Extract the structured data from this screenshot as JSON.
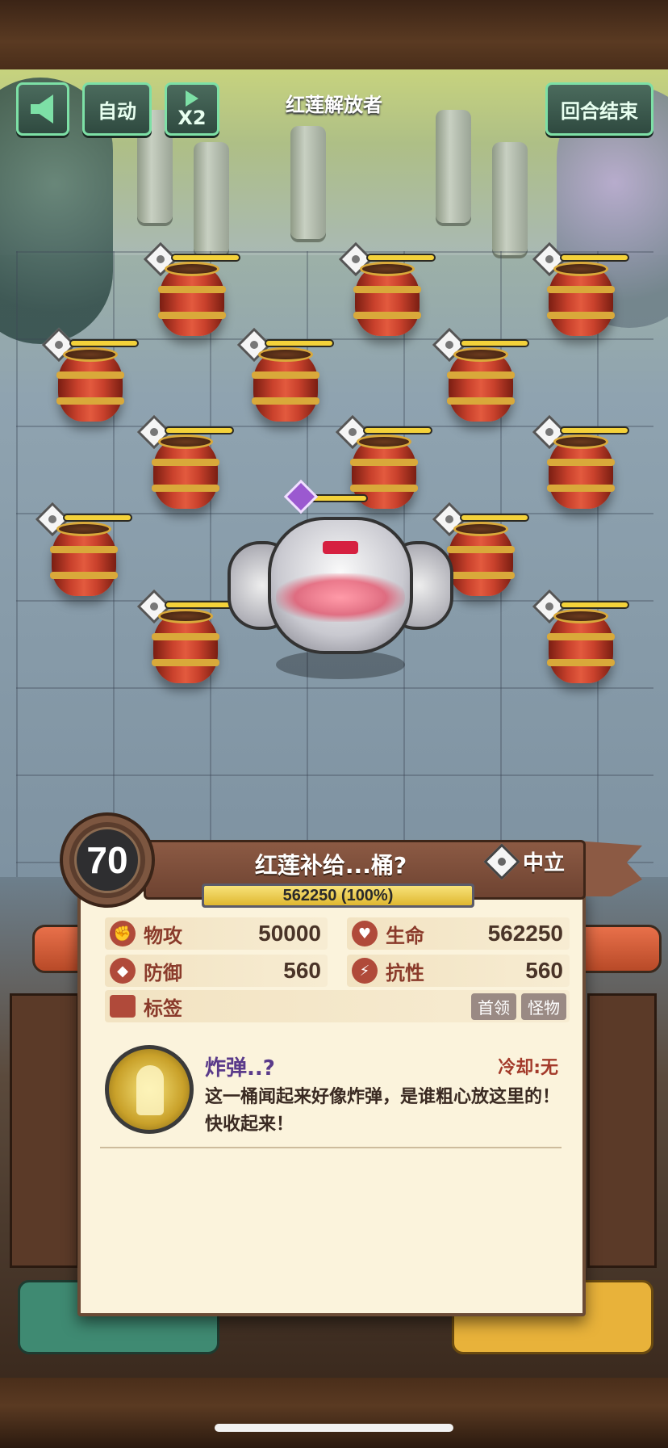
{
  "top_bar": {
    "auto_label": "自动",
    "speed_label": "X2",
    "stage_title": "红莲解放者",
    "end_turn_label": "回合结束"
  },
  "card": {
    "level": "70",
    "name": "红莲补给...桶?",
    "faction": "中立",
    "hp_text": "562250 (100%)",
    "hp_percent": 100,
    "stats": {
      "atk_label": "物攻",
      "atk_value": "50000",
      "hp_label": "生命",
      "hp_value": "562250",
      "def_label": "防御",
      "def_value": "560",
      "res_label": "抗性",
      "res_value": "560"
    },
    "tags_label": "标签",
    "tags": [
      "首领",
      "怪物"
    ],
    "skill": {
      "name": "炸弹..?",
      "cooldown": "冷却:无",
      "description": "这一桶闻起来好像炸弹，是谁粗心放这里的！快收起来！"
    }
  },
  "colors": {
    "hp_yellow": "#f4d23a",
    "button_green": "#7de0a6",
    "card_bg": "#fbf3dc",
    "header_brown": "#8c5a44"
  }
}
